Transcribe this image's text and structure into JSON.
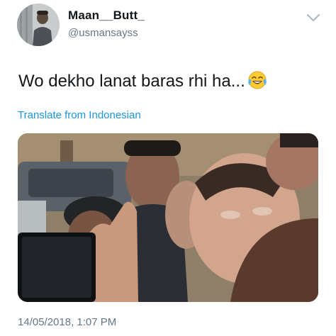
{
  "author": {
    "display_name": "Maan__Butt_",
    "handle": "@usmansayss",
    "avatar_icon": "profile-photo"
  },
  "menu": {
    "icon": "chevron-down-icon"
  },
  "tweet": {
    "text": "Wo dekho lanat baras rhi ha...",
    "emoji": "face-with-tears-of-joy",
    "translate_label": "Translate from Indonesian"
  },
  "media": {
    "type": "photo"
  },
  "meta": {
    "timestamp": "14/05/2018, 1:07 PM"
  },
  "colors": {
    "text": "#14171a",
    "secondary": "#657786",
    "link": "#1b95e0"
  }
}
